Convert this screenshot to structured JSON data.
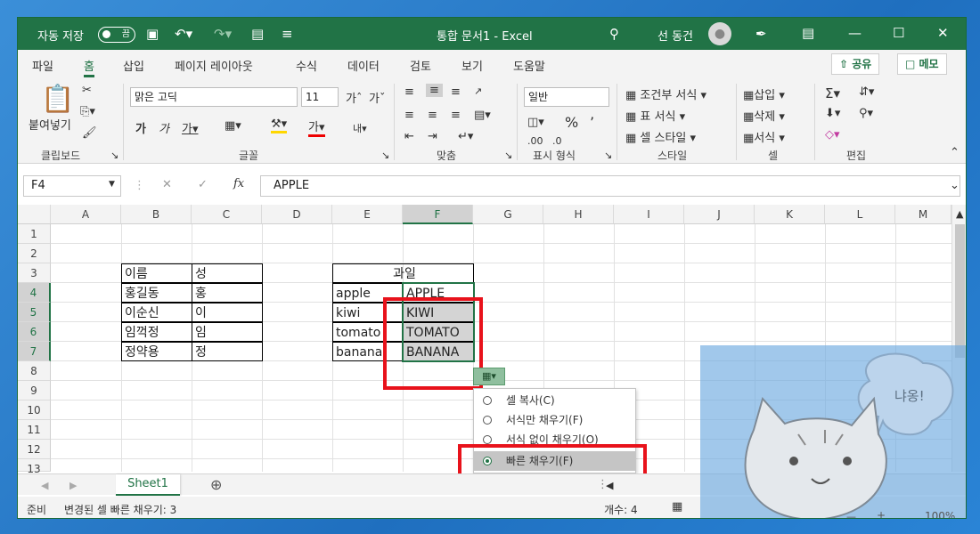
{
  "titlebar": {
    "autosave_label": "자동 저장",
    "autosave_state": "끔",
    "title": "통합 문서1  -  Excel",
    "user": "선 동건"
  },
  "tabs": [
    "파일",
    "홈",
    "삽입",
    "페이지 레이아웃",
    "수식",
    "데이터",
    "검토",
    "보기",
    "도움말"
  ],
  "active_tab": "홈",
  "share_label": "공유",
  "memo_label": "메모",
  "ribbon": {
    "clipboard": {
      "paste": "붙여넣기",
      "label": "클립보드"
    },
    "font": {
      "name": "맑은 고딕",
      "size": "11",
      "label": "글꼴"
    },
    "align": {
      "label": "맞춤"
    },
    "number": {
      "format": "일반",
      "label": "표시 형식"
    },
    "styles": {
      "cond": "조건부 서식",
      "table": "표 서식",
      "cell": "셀 스타일",
      "label": "스타일"
    },
    "cells": {
      "insert": "삽입",
      "delete": "삭제",
      "format": "서식",
      "label": "셀"
    },
    "edit": {
      "label": "편집"
    }
  },
  "formula": {
    "namebox": "F4",
    "value": "APPLE"
  },
  "columns": [
    "A",
    "B",
    "C",
    "D",
    "E",
    "F",
    "G",
    "H",
    "I",
    "J",
    "K",
    "L",
    "M"
  ],
  "rows": [
    "1",
    "2",
    "3",
    "4",
    "5",
    "6",
    "7",
    "8",
    "9",
    "10",
    "11",
    "12",
    "13"
  ],
  "table1": {
    "header": [
      "이름",
      "성"
    ],
    "rows": [
      [
        "홍길동",
        "홍"
      ],
      [
        "이순신",
        "이"
      ],
      [
        "임꺽정",
        "임"
      ],
      [
        "정약용",
        "정"
      ]
    ]
  },
  "table2": {
    "header": "과일",
    "rows": [
      [
        "apple",
        "APPLE"
      ],
      [
        "kiwi",
        "KIWI"
      ],
      [
        "tomato",
        "TOMATO"
      ],
      [
        "banana",
        "BANANA"
      ]
    ]
  },
  "flashfill_menu": [
    {
      "label": "셀 복사(C)",
      "selected": false
    },
    {
      "label": "서식만 채우기(F)",
      "selected": false
    },
    {
      "label": "서식 없이 채우기(O)",
      "selected": false
    },
    {
      "label": "빠른 채우기(F)",
      "selected": true
    }
  ],
  "sheet_tab": "Sheet1",
  "status": {
    "ready": "준비",
    "message": "변경된 셀 빠른 채우기: 3",
    "count": "개수: 4",
    "zoom": "100%"
  },
  "overlay": {
    "speech": "냐옹!"
  },
  "colors": {
    "excel_green": "#217346",
    "highlight_red": "#e8121b",
    "fill_gray": "#d4d4d4"
  }
}
